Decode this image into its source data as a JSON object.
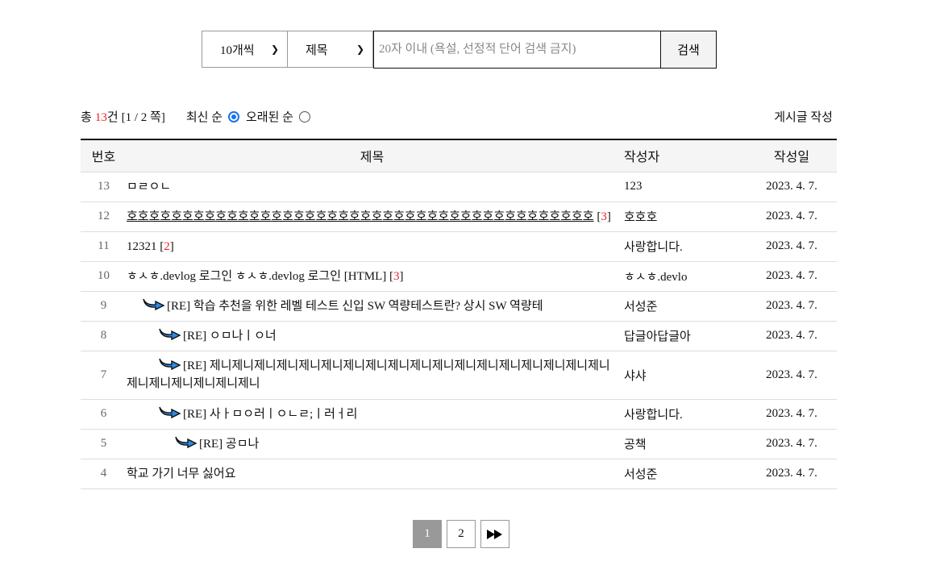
{
  "search": {
    "per_page": "10개씩",
    "field": "제목",
    "placeholder": "20자 이내 (욕설, 선정적 단어 검색 금지)",
    "button": "검색"
  },
  "summary": {
    "prefix": "총",
    "count": "13",
    "suffix": "건",
    "page_info": "[1 / 2 쪽]",
    "sort_newest": "최신 순",
    "sort_oldest": "오래된 순",
    "selected_sort": "newest"
  },
  "write_label": "게시글 작성",
  "table": {
    "headers": {
      "no": "번호",
      "title": "제목",
      "author": "작성자",
      "date": "작성일"
    },
    "rows": [
      {
        "no": "13",
        "title": "ㅁㄹㅇㄴ",
        "comments": "",
        "author": "123",
        "date": "2023. 4. 7.",
        "depth": 0
      },
      {
        "no": "12",
        "title": "호호호호호호호호호호호호호호호호호호호호호호호호호호호호호호호호호호호호호호호호호호",
        "comments": "3",
        "author": "호호호",
        "date": "2023. 4. 7.",
        "depth": 0
      },
      {
        "no": "11",
        "title": "12321",
        "comments": "2",
        "author": "사랑합니다.",
        "date": "2023. 4. 7.",
        "depth": 0
      },
      {
        "no": "10",
        "title": "ㅎㅅㅎ.devlog 로그인 ㅎㅅㅎ.devlog 로그인 [HTML]",
        "comments": "3",
        "author": "ㅎㅅㅎ.devlo",
        "date": "2023. 4. 7.",
        "depth": 0
      },
      {
        "no": "9",
        "title": "[RE] 학습 추천을 위한 레벨 테스트 신입 SW 역량테스트란? 상시 SW 역량테",
        "comments": "",
        "author": "서성준",
        "date": "2023. 4. 7.",
        "depth": 1
      },
      {
        "no": "8",
        "title": "[RE] ㅇㅁ나ㅣㅇ너",
        "comments": "",
        "author": "답글아답글아",
        "date": "2023. 4. 7.",
        "depth": 2
      },
      {
        "no": "7",
        "title": "[RE] 제니제니제니제니제니제니제니제니제니제니제니제니제니제니제니제니제니제니제니제니제니제니제니제니",
        "comments": "",
        "author": "샤샤",
        "date": "2023. 4. 7.",
        "depth": 2
      },
      {
        "no": "6",
        "title": "[RE] 사ㅏㅁㅇ러ㅣㅇㄴㄹ;ㅣ러ㅓ리",
        "comments": "",
        "author": "사랑합니다.",
        "date": "2023. 4. 7.",
        "depth": 2
      },
      {
        "no": "5",
        "title": "[RE] 공ㅁ나",
        "comments": "",
        "author": "공책",
        "date": "2023. 4. 7.",
        "depth": 3
      },
      {
        "no": "4",
        "title": "학교 가기 너무 싫어요",
        "comments": "",
        "author": "서성준",
        "date": "2023. 4. 7.",
        "depth": 0
      }
    ]
  },
  "pagination": {
    "pages": [
      "1",
      "2"
    ],
    "current": "1",
    "next_icon": "fast-forward-icon"
  },
  "colors": {
    "comment_count": "#e8232a",
    "reply_arrow": "#2a8be6",
    "active_page": "#999999"
  }
}
